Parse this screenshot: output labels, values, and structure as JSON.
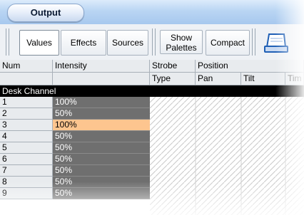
{
  "window": {
    "title": "Output"
  },
  "toolbar": {
    "tabs": [
      "Values",
      "Effects",
      "Sources"
    ],
    "show_palettes": [
      "Show",
      "Palettes"
    ],
    "compact": "Compact",
    "print_icon": "printer-icon"
  },
  "header": {
    "row1": {
      "num": "Num",
      "intensity": "Intensity",
      "strobe": "Strobe",
      "position": "Position"
    },
    "row2": {
      "type": "Type",
      "pan": "Pan",
      "tilt": "Tilt",
      "tim": "Tim"
    }
  },
  "section": {
    "label": "Desk Channel"
  },
  "rows": [
    {
      "num": "1",
      "intensity": "100%"
    },
    {
      "num": "2",
      "intensity": "50%"
    },
    {
      "num": "3",
      "intensity": "100%"
    },
    {
      "num": "4",
      "intensity": "50%"
    },
    {
      "num": "5",
      "intensity": "50%"
    },
    {
      "num": "6",
      "intensity": "50%"
    },
    {
      "num": "7",
      "intensity": "50%"
    },
    {
      "num": "8",
      "intensity": "50%"
    },
    {
      "num": "9",
      "intensity": "50%"
    }
  ],
  "colors": {
    "selected_row": "#fdc58f",
    "intensity_bg": "#6f6f6f",
    "section_bg": "#000000"
  }
}
